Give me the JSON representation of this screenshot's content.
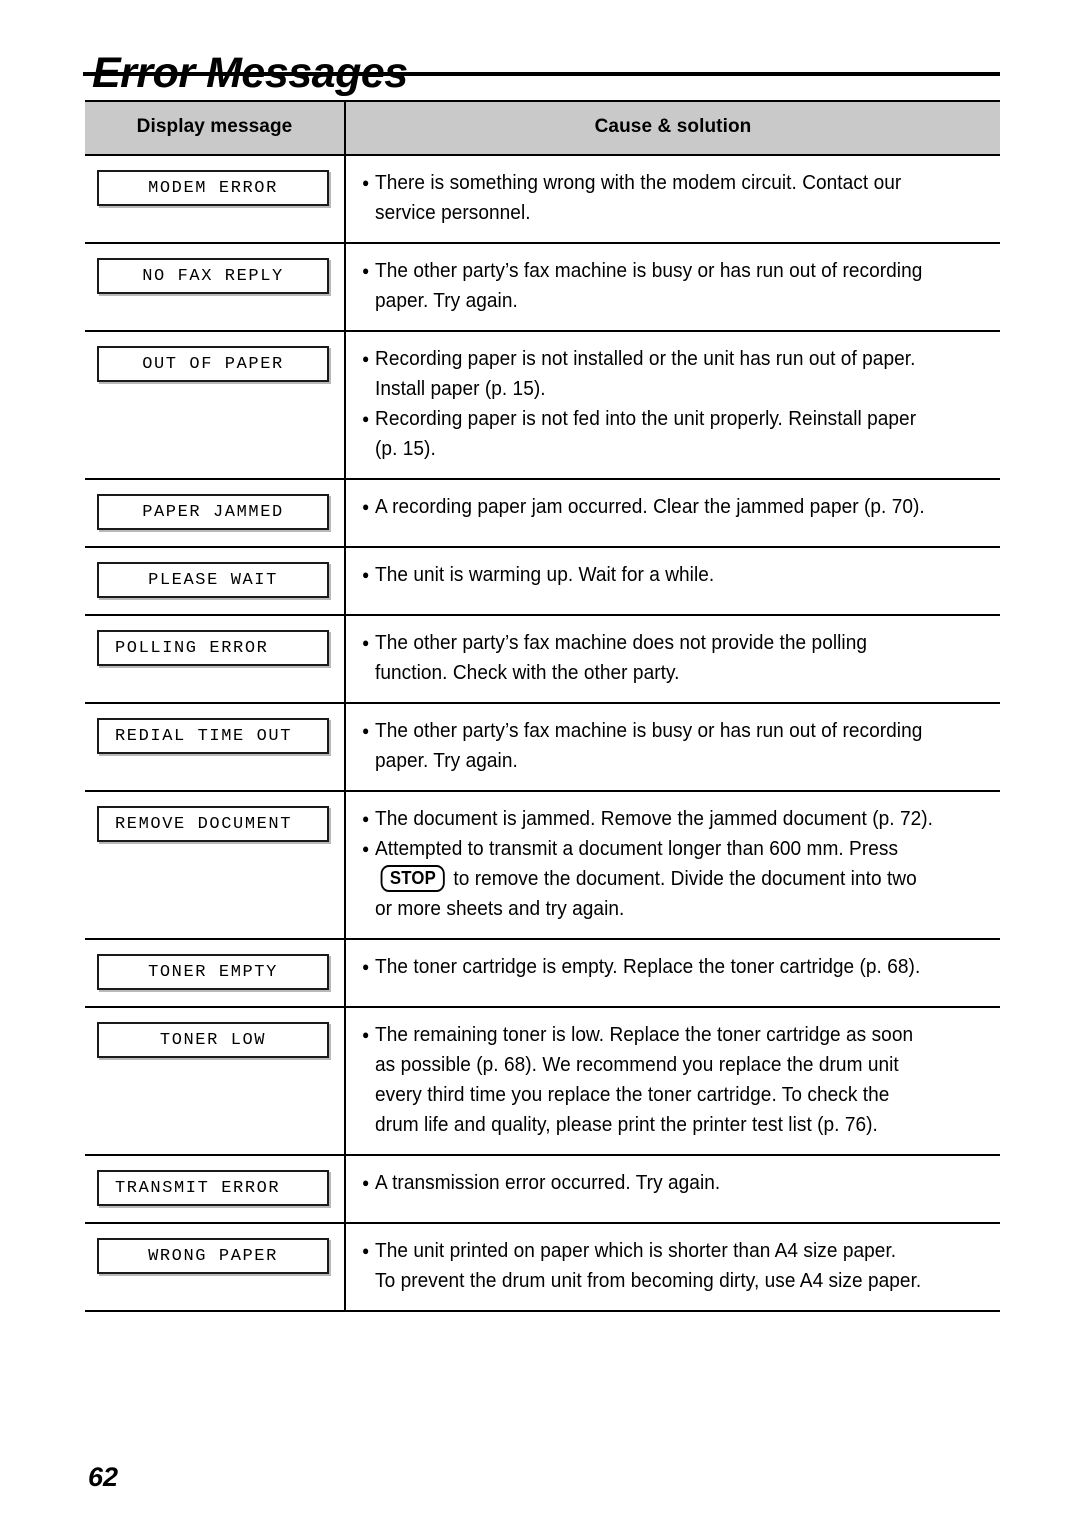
{
  "heading": "Error Messages",
  "page_number": "62",
  "table": {
    "columns": [
      "Display message",
      "Cause & solution"
    ],
    "rows": [
      {
        "display_message": "MODEM ERROR",
        "align": "center",
        "lines": [
          {
            "bullet": true,
            "text": "There is something wrong with the modem circuit. Contact our"
          },
          {
            "bullet": false,
            "text": "service personnel."
          }
        ]
      },
      {
        "display_message": "NO FAX REPLY",
        "align": "center",
        "lines": [
          {
            "bullet": true,
            "text": "The other party’s fax machine is busy or has run out of recording"
          },
          {
            "bullet": false,
            "text": "paper. Try again."
          }
        ]
      },
      {
        "display_message": "OUT OF PAPER",
        "align": "center",
        "lines": [
          {
            "bullet": true,
            "text": "Recording paper is not installed or the unit has run out of paper."
          },
          {
            "bullet": false,
            "text": "Install paper (p. 15)."
          },
          {
            "bullet": true,
            "text": "Recording paper is not fed into the unit properly. Reinstall paper"
          },
          {
            "bullet": false,
            "text": "(p. 15)."
          }
        ]
      },
      {
        "display_message": "PAPER JAMMED",
        "align": "center",
        "lines": [
          {
            "bullet": true,
            "text": "A recording paper jam occurred. Clear the jammed paper (p. 70)."
          }
        ]
      },
      {
        "display_message": "PLEASE WAIT",
        "align": "center",
        "lines": [
          {
            "bullet": true,
            "text": "The unit is warming up. Wait for a while."
          }
        ]
      },
      {
        "display_message": "POLLING ERROR",
        "align": "left",
        "lines": [
          {
            "bullet": true,
            "text": "The other party’s fax machine does not provide the polling"
          },
          {
            "bullet": false,
            "text": "function. Check with the other party."
          }
        ]
      },
      {
        "display_message": "REDIAL TIME OUT",
        "align": "left",
        "lines": [
          {
            "bullet": true,
            "text": "The other party’s fax machine is busy or has run out of recording"
          },
          {
            "bullet": false,
            "text": "paper. Try again."
          }
        ]
      },
      {
        "display_message": "REMOVE DOCUMENT",
        "align": "left",
        "lines": [
          {
            "bullet": true,
            "text": "The document is jammed. Remove the jammed document (p. 72)."
          },
          {
            "bullet": true,
            "text": "Attempted to transmit a document longer than 600 mm. Press"
          },
          {
            "bullet": false,
            "key": "STOP",
            "text_before": "",
            "text_after": "to remove the document. Divide the document into two"
          },
          {
            "bullet": false,
            "text": "or more sheets and try again."
          }
        ]
      },
      {
        "display_message": "TONER EMPTY",
        "align": "center",
        "lines": [
          {
            "bullet": true,
            "text": "The toner cartridge is empty. Replace the toner cartridge (p. 68)."
          }
        ]
      },
      {
        "display_message": "TONER LOW",
        "align": "center",
        "lines": [
          {
            "bullet": true,
            "text": "The remaining toner is low. Replace the toner cartridge as soon"
          },
          {
            "bullet": false,
            "text": "as possible (p. 68). We recommend you replace the drum unit"
          },
          {
            "bullet": false,
            "text": "every third time you replace the toner cartridge. To check the"
          },
          {
            "bullet": false,
            "text": "drum life and quality, please print the printer test list (p. 76)."
          }
        ]
      },
      {
        "display_message": "TRANSMIT ERROR",
        "align": "left",
        "lines": [
          {
            "bullet": true,
            "text": "A transmission error occurred. Try again."
          }
        ]
      },
      {
        "display_message": "WRONG PAPER",
        "align": "center",
        "lines": [
          {
            "bullet": true,
            "text": "The unit printed on paper which is shorter than A4 size paper."
          },
          {
            "bullet": false,
            "text": "To prevent the drum unit from becoming dirty, use A4 size paper."
          }
        ]
      }
    ]
  }
}
